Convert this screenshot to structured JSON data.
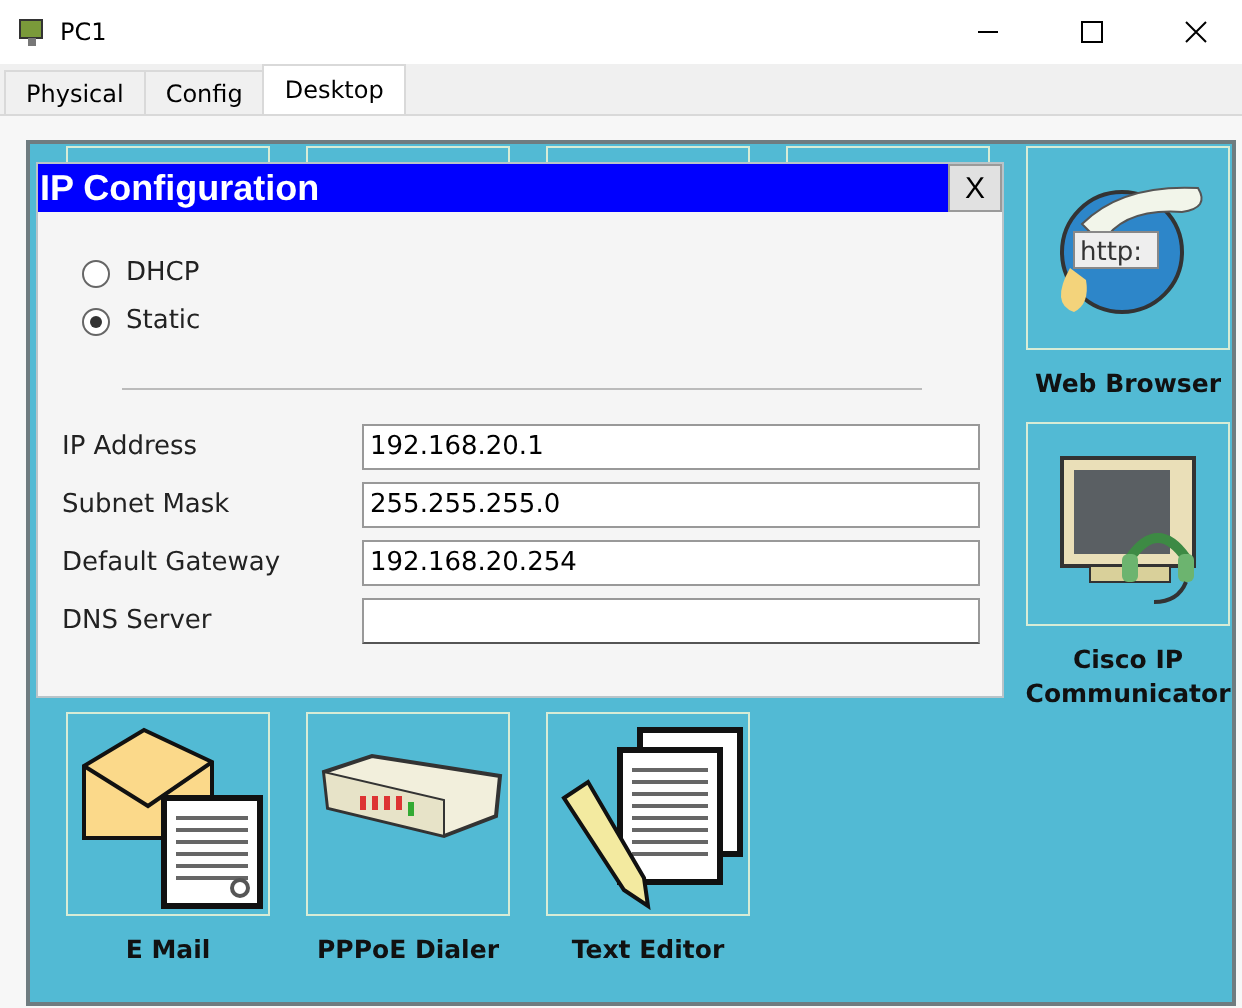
{
  "window": {
    "title": "PC1"
  },
  "tabs": [
    {
      "label": "Physical",
      "selected": false
    },
    {
      "label": "Config",
      "selected": false
    },
    {
      "label": "Desktop",
      "selected": true
    }
  ],
  "dialog": {
    "title": "IP Configuration",
    "close": "X",
    "modes": [
      {
        "label": "DHCP",
        "selected": false
      },
      {
        "label": "Static",
        "selected": true
      }
    ],
    "fields": [
      {
        "label": "IP Address",
        "value": "192.168.20.1"
      },
      {
        "label": "Subnet Mask",
        "value": "255.255.255.0"
      },
      {
        "label": "Default Gateway",
        "value": "192.168.20.254"
      },
      {
        "label": "DNS Server"
      }
    ]
  },
  "apps": [
    {
      "label": "Web Browser",
      "kind": "browser",
      "icon_text": "http:"
    },
    {
      "label": "Cisco IP Communicator",
      "kind": "phone"
    },
    {
      "label": "E Mail",
      "kind": "mail"
    },
    {
      "label": "PPPoE Dialer",
      "kind": "dialer"
    },
    {
      "label": "Text Editor",
      "kind": "editor"
    }
  ]
}
